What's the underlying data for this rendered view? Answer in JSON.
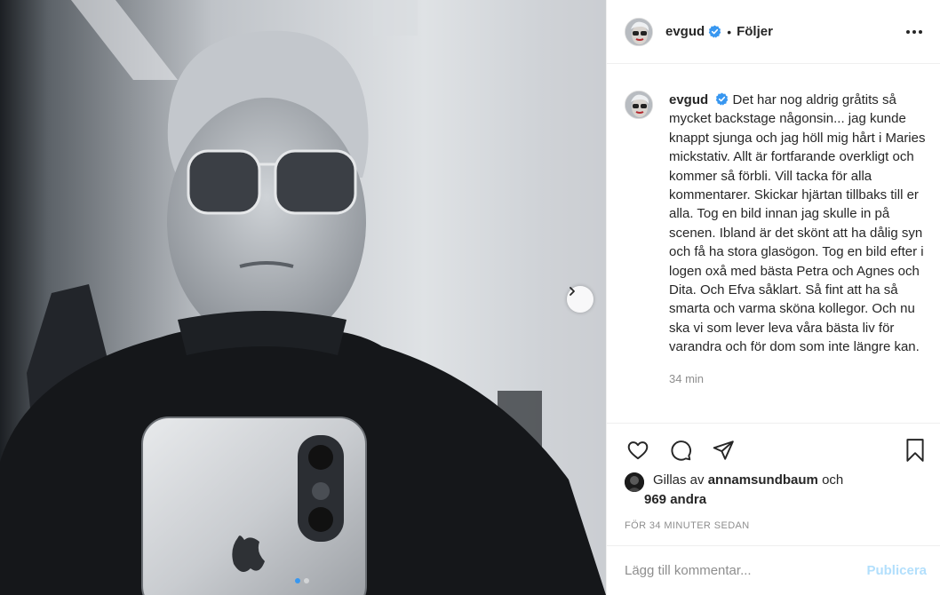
{
  "post": {
    "username": "evgud",
    "follow_separator": "•",
    "follow_label": "Följer",
    "caption": "Det har nog aldrig gråtits så mycket backstage någonsin... jag kunde knappt sjunga och jag höll mig hårt i Maries mickstativ. Allt är fortfarande overkligt och kommer så förbli. Vill tacka för alla kommentarer. Skickar hjärtan tillbaks till er alla. Tog en bild innan jag skulle in på scenen. Ibland är det skönt att ha dålig syn och få ha stora glasögon. Tog en bild efter i logen oxå med bästa Petra och Agnes och Dita. Och Efva såklart. Så fint att ha så smarta och varma sköna kollegor. Och nu ska vi som lever leva våra bästa liv för varandra och för dom som inte längre kan.",
    "caption_time": "34 min"
  },
  "likes": {
    "prefix": "Gillas av",
    "liker": "annamsundbaum",
    "conjunction": "och",
    "others": "969 andra"
  },
  "timestamp": "FÖR 34 MINUTER SEDAN",
  "comment": {
    "placeholder": "Lägg till kommentar...",
    "post_label": "Publicera"
  },
  "carousel": {
    "current": 1,
    "total": 2
  },
  "icons": {
    "verified": "verified-badge-icon",
    "more": "more-options-icon",
    "like": "heart-icon",
    "comment": "comment-bubble-icon",
    "share": "paper-plane-icon",
    "save": "bookmark-icon",
    "next": "chevron-right-icon"
  },
  "colors": {
    "verified": "#3897f0",
    "post_disabled": "#b2dffc",
    "muted": "#8e8e8e"
  }
}
